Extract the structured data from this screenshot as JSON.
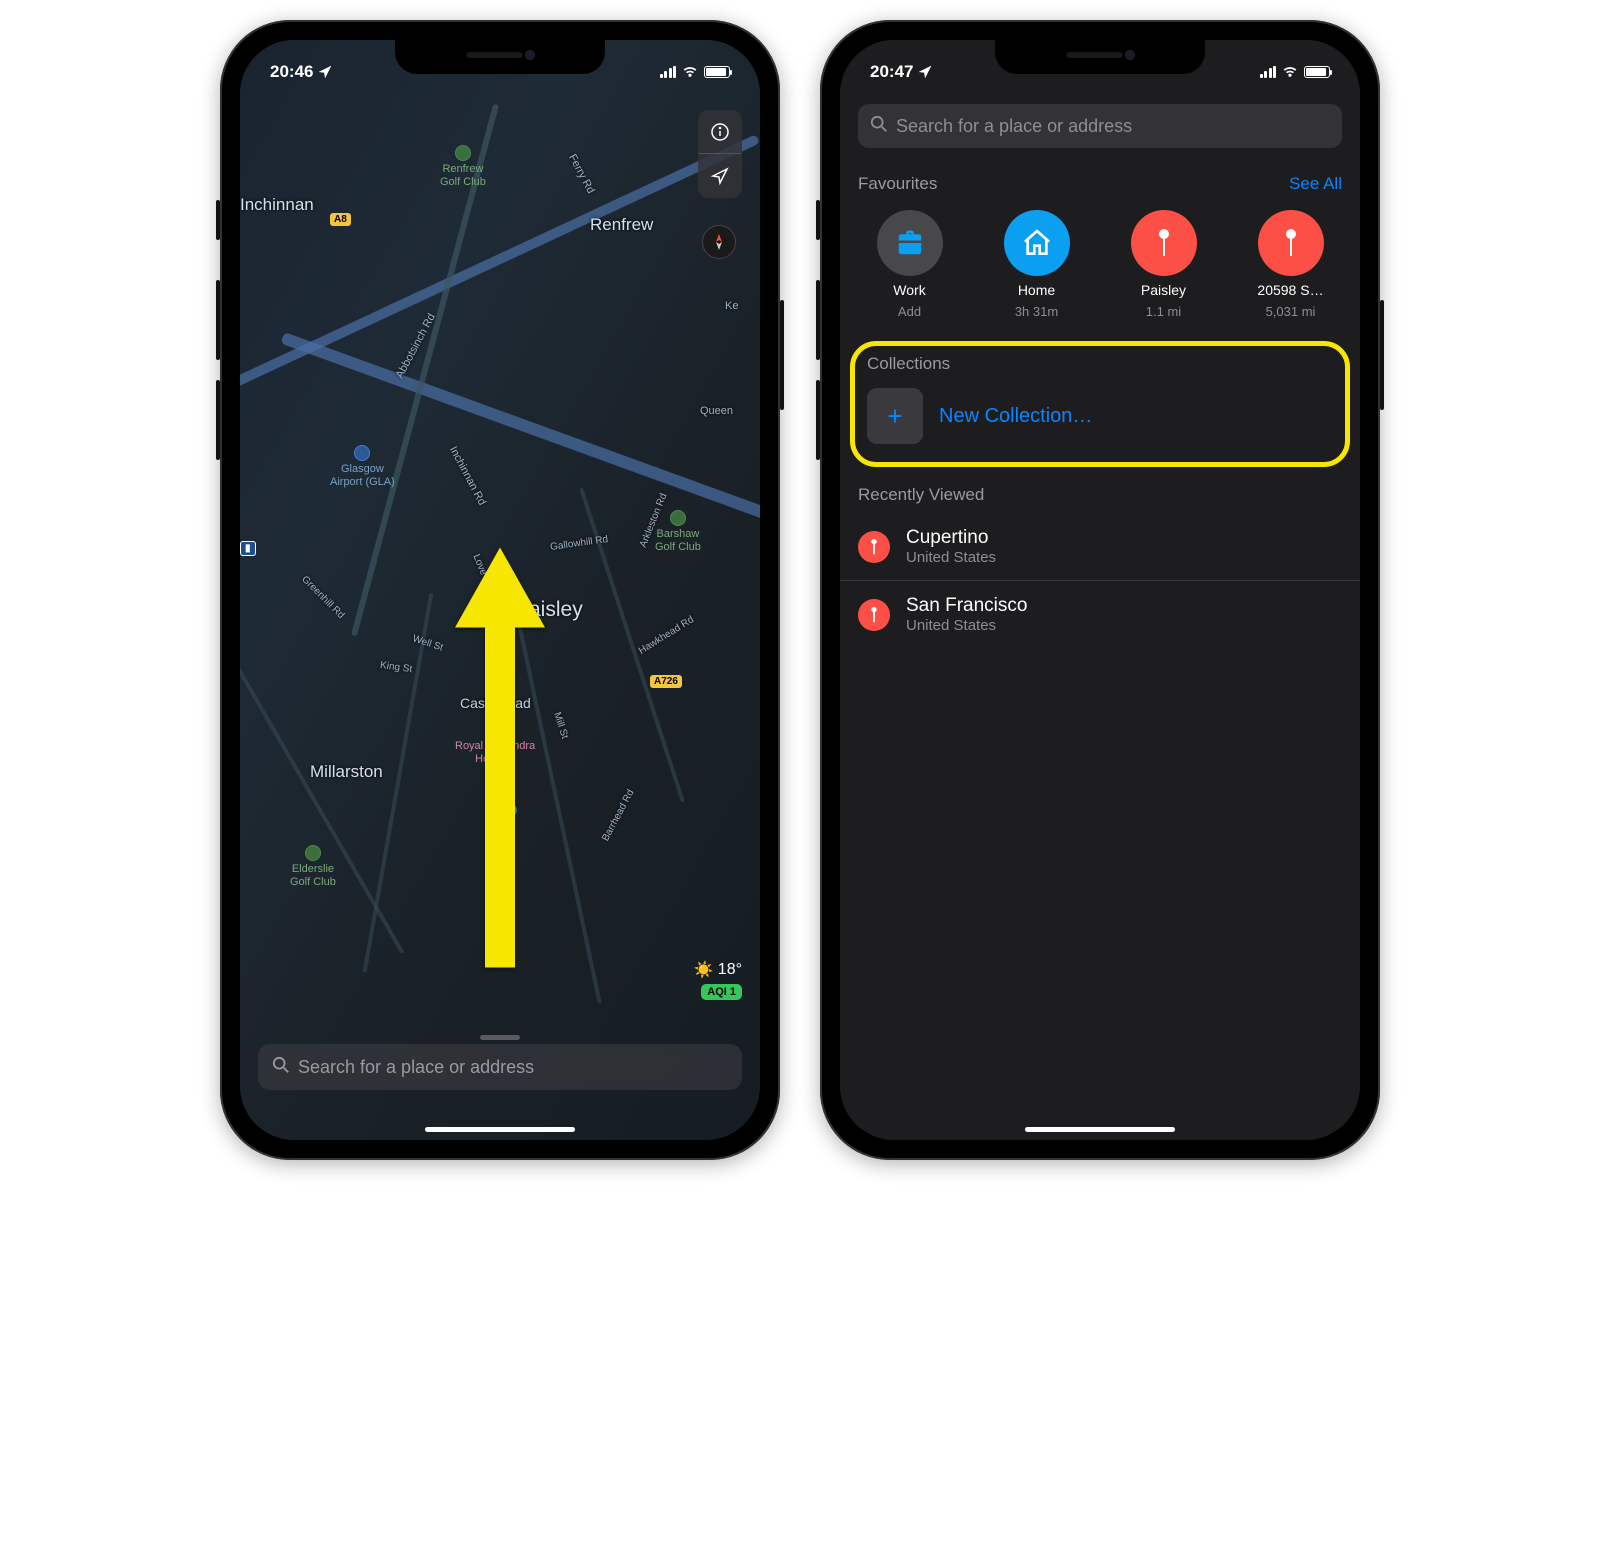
{
  "left": {
    "status": {
      "time": "20:46"
    },
    "search_placeholder": "Search for a place or address",
    "weather": {
      "temp": "18°",
      "aqi": "AQI 1"
    },
    "labels": {
      "inchinnan": "Inchinnan",
      "renfrew": "Renfrew",
      "paisley": "Paisley",
      "millarston": "Millarston",
      "castlehead": "Castlehead",
      "renfrew_golf": "Renfrew\nGolf Club",
      "barshaw_golf": "Barshaw\nGolf Club",
      "elderslie_golf": "Elderslie\nGolf Club",
      "glasgow_airport": "Glasgow\nAirport (GLA)",
      "royal_hospital": "Royal Alexandra\nHospital",
      "ferry_rd": "Ferry Rd",
      "abbotsinch_rd": "Abbotsinch Rd",
      "inchinnan_rd": "Inchinnan Rd",
      "love_st": "Love St",
      "well_st": "Well St",
      "king_st": "King St",
      "greenhill_rd": "Greenhill Rd",
      "mill_st": "Mill St",
      "gallowhill_rd": "Gallowhill Rd",
      "arkleston_rd": "Arkleston Rd",
      "hawkhead_rd": "Hawkhead Rd",
      "barrhead_rd": "Barrhead Rd",
      "queen": "Queen",
      "ke": "Ke",
      "a8": "A8",
      "a726": "A726"
    }
  },
  "right": {
    "status": {
      "time": "20:47"
    },
    "search_placeholder": "Search for a place or address",
    "favourites": {
      "title": "Favourites",
      "see_all": "See All",
      "items": [
        {
          "label": "Work",
          "sub": "Add",
          "color": "grey",
          "icon": "briefcase"
        },
        {
          "label": "Home",
          "sub": "3h 31m",
          "color": "blue",
          "icon": "house"
        },
        {
          "label": "Paisley",
          "sub": "1.1 mi",
          "color": "red",
          "icon": "pin"
        },
        {
          "label": "20598 S…",
          "sub": "5,031 mi",
          "color": "red",
          "icon": "pin"
        }
      ]
    },
    "collections": {
      "title": "Collections",
      "new_label": "New Collection…"
    },
    "recently": {
      "title": "Recently Viewed",
      "items": [
        {
          "title": "Cupertino",
          "sub": "United States"
        },
        {
          "title": "San Francisco",
          "sub": "United States"
        }
      ]
    }
  }
}
